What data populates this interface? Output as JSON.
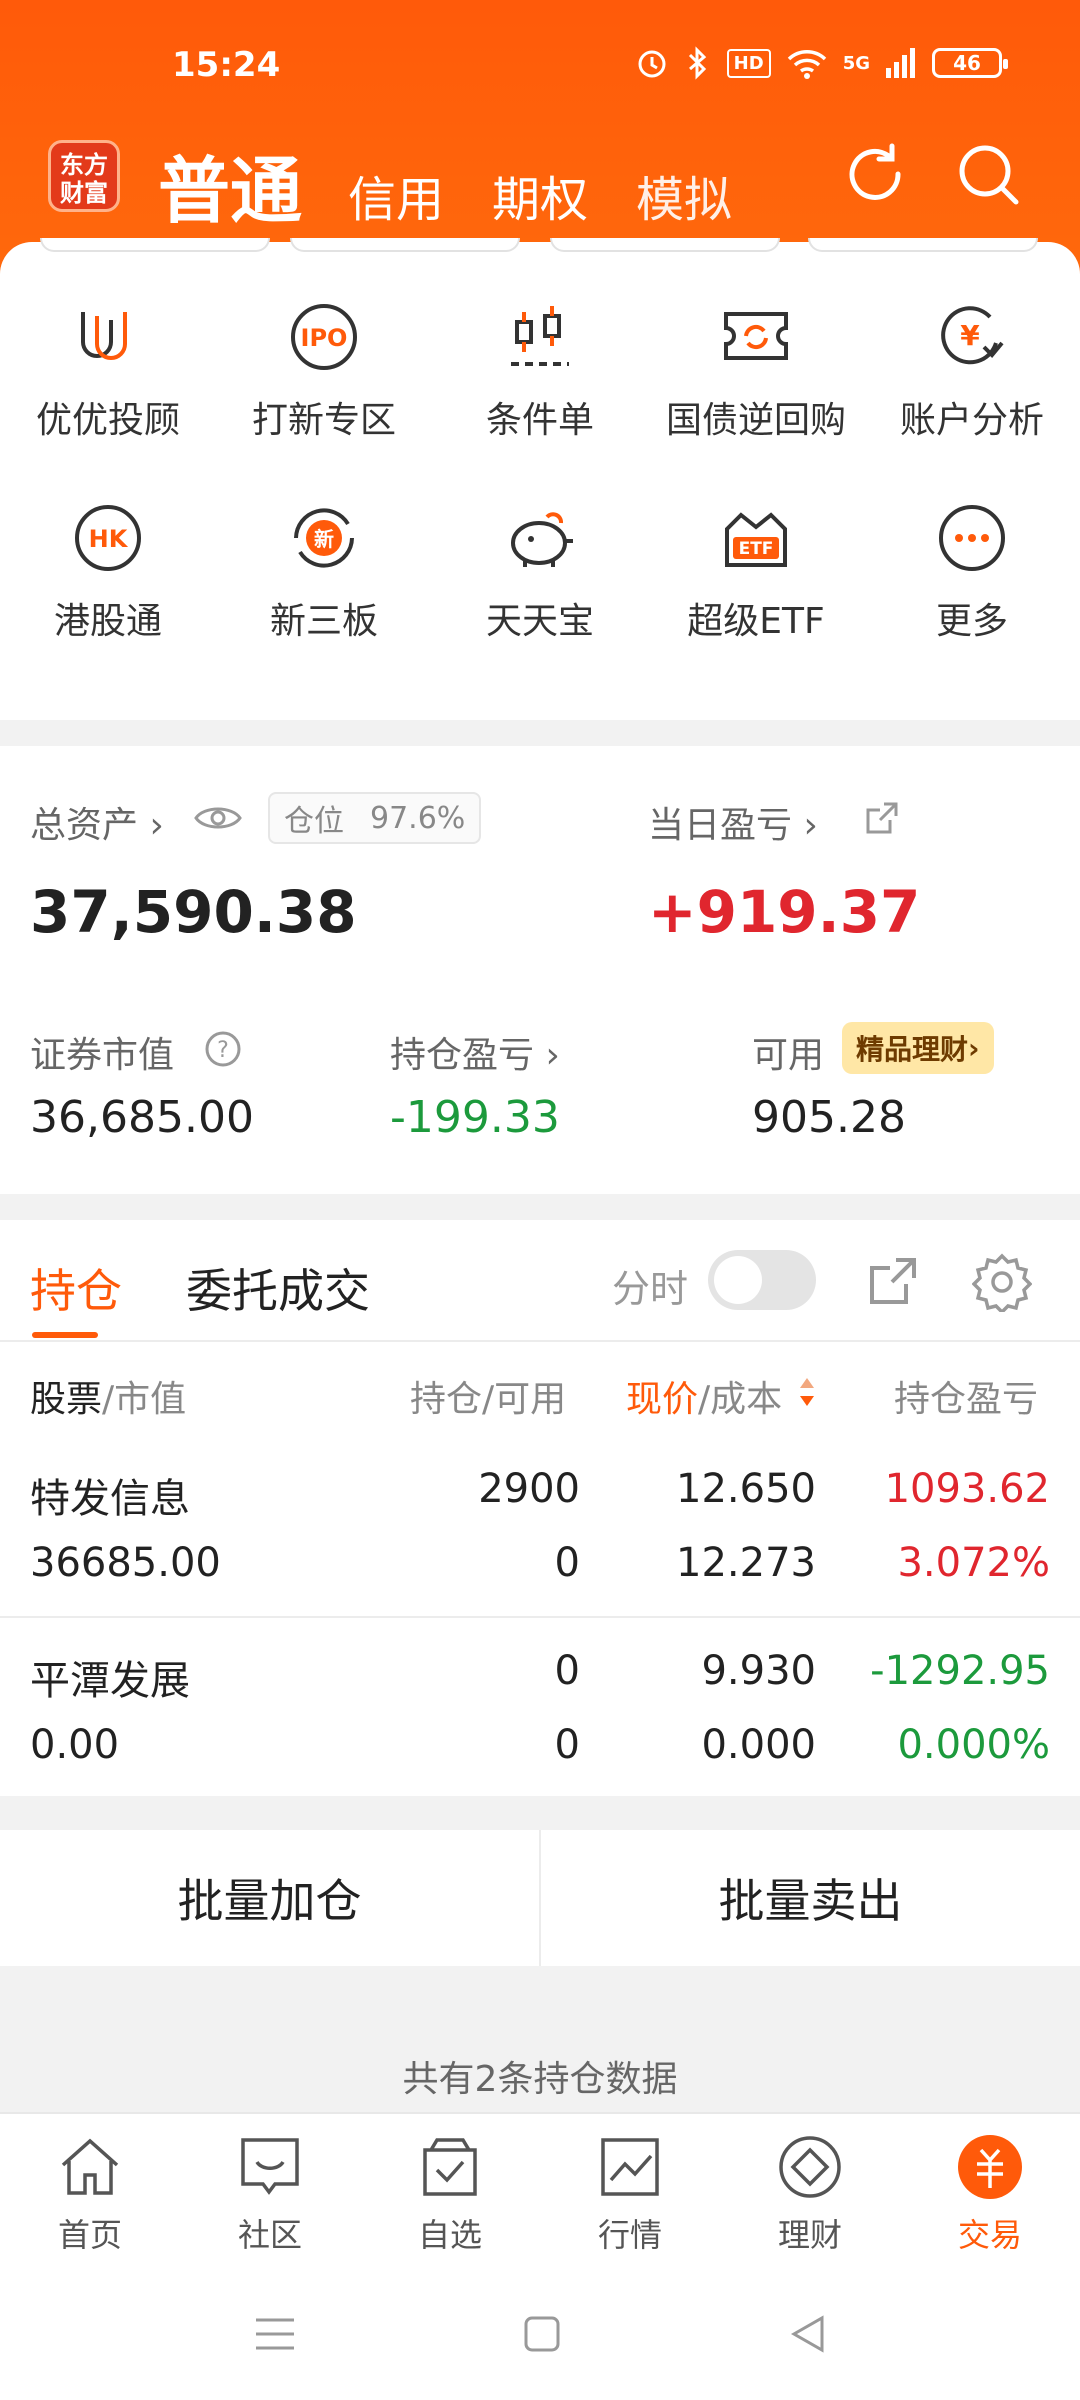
{
  "status": {
    "time": "15:24",
    "battery": "46",
    "hd": "HD",
    "net": "5G"
  },
  "header": {
    "logo": "东方财富",
    "tabs": [
      "普通",
      "信用",
      "期权",
      "模拟"
    ]
  },
  "menu": [
    {
      "label": "优优投顾",
      "icon": "uu-advisor-icon"
    },
    {
      "label": "打新专区",
      "icon": "ipo-icon"
    },
    {
      "label": "条件单",
      "icon": "conditional-order-icon"
    },
    {
      "label": "国债逆回购",
      "icon": "repo-icon"
    },
    {
      "label": "账户分析",
      "icon": "account-analysis-icon"
    },
    {
      "label": "港股通",
      "icon": "hk-icon"
    },
    {
      "label": "新三板",
      "icon": "neeq-icon"
    },
    {
      "label": "天天宝",
      "icon": "piggy-icon"
    },
    {
      "label": "超级ETF",
      "icon": "etf-icon"
    },
    {
      "label": "更多",
      "icon": "more-icon"
    }
  ],
  "asset": {
    "total_label": "总资产",
    "position_label": "仓位",
    "position_value": "97.6%",
    "total_value": "37,590.38",
    "daily_label": "当日盈亏",
    "daily_value": "+919.37",
    "market_label": "证券市值",
    "market_value": "36,685.00",
    "hold_pl_label": "持仓盈亏",
    "hold_pl_value": "-199.33",
    "avail_label": "可用",
    "avail_value": "905.28",
    "promo": "精品理财"
  },
  "holdings": {
    "tab_positions": "持仓",
    "tab_orders": "委托成交",
    "intraday_label": "分时",
    "col_stock": "股票",
    "col_value": "/市值",
    "col_qty": "持仓/可用",
    "col_price": "现价",
    "col_cost": "/成本",
    "col_pl": "持仓盈亏",
    "rows": [
      {
        "name": "特发信息",
        "market_value": "36685.00",
        "qty": "2900",
        "avail": "0",
        "price": "12.650",
        "cost": "12.273",
        "pl": "1093.62",
        "pl_pct": "3.072%"
      },
      {
        "name": "平潭发展",
        "market_value": "0.00",
        "qty": "0",
        "avail": "0",
        "price": "9.930",
        "cost": "0.000",
        "pl": "-1292.95",
        "pl_pct": "0.000%"
      }
    ],
    "batch_add": "批量加仓",
    "batch_sell": "批量卖出",
    "count_text": "共有2条持仓数据"
  },
  "nav": [
    {
      "label": "首页",
      "icon": "home-icon"
    },
    {
      "label": "社区",
      "icon": "community-icon"
    },
    {
      "label": "自选",
      "icon": "watchlist-icon"
    },
    {
      "label": "行情",
      "icon": "market-icon"
    },
    {
      "label": "理财",
      "icon": "wealth-icon"
    },
    {
      "label": "交易",
      "icon": "trade-icon"
    }
  ],
  "colors": {
    "accent": "#ff5a0a",
    "up": "#e0262e",
    "down": "#1c9a3c"
  }
}
